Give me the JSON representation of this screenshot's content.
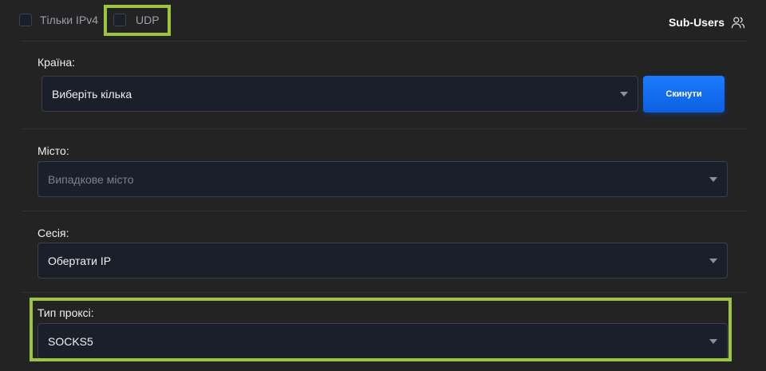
{
  "top": {
    "ipv4_label": "Тільки IPv4",
    "udp_label": "UDP",
    "subusers_label": "Sub-Users"
  },
  "country": {
    "label": "Країна:",
    "value": "Виберіть кілька",
    "reset_label": "Скинути"
  },
  "city": {
    "label": "Місто:",
    "placeholder": "Випадкове місто"
  },
  "session": {
    "label": "Сесія:",
    "value": "Обертати IP"
  },
  "proxy_type": {
    "label": "Тип проксі:",
    "value": "SOCKS5"
  },
  "colors": {
    "background": "#232323",
    "field": "#1b1f2a",
    "accent": "#1c7bff",
    "highlight": "#9cc43d"
  },
  "icons": [
    "users-icon",
    "chevron-down-icon"
  ]
}
